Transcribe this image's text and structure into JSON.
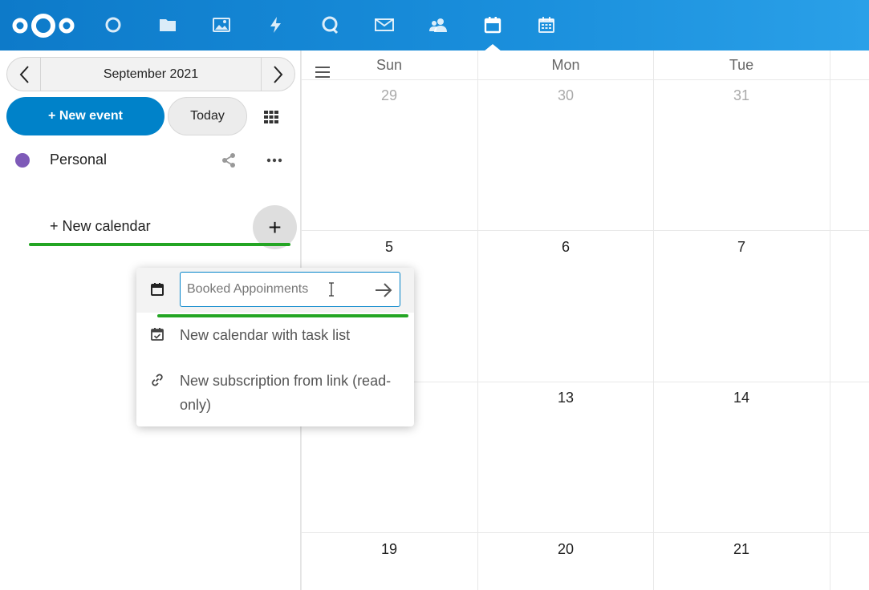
{
  "header": {
    "apps": [
      {
        "icon": "dashboard-icon"
      },
      {
        "icon": "files-icon"
      },
      {
        "icon": "photos-icon"
      },
      {
        "icon": "activity-icon"
      },
      {
        "icon": "talk-icon"
      },
      {
        "icon": "mail-icon"
      },
      {
        "icon": "contacts-icon"
      },
      {
        "icon": "calendar-icon"
      },
      {
        "icon": "appointments-icon"
      }
    ],
    "active_app": "calendar-icon",
    "colors": {
      "gradient_start": "#0d7ac9",
      "gradient_end": "#2aa0e8"
    }
  },
  "sidebar": {
    "month_label": "September 2021",
    "new_event_label": "+ New event",
    "today_label": "Today",
    "calendars": [
      {
        "name": "Personal",
        "color": "#7e5ab8"
      }
    ],
    "new_calendar_label": "+ New calendar",
    "plus_symbol": "+"
  },
  "popover": {
    "input_placeholder": "Booked Appoinments",
    "items": [
      {
        "label": "New calendar with task list",
        "icon": "calendar-check-icon"
      },
      {
        "label": "New subscription from link (read-only)",
        "icon": "link-icon"
      }
    ]
  },
  "calendar": {
    "day_headers": [
      "Sun",
      "Mon",
      "Tue"
    ],
    "weeks": [
      [
        "29",
        "30",
        "31"
      ],
      [
        "5",
        "6",
        "7"
      ],
      [
        "",
        "13",
        "14"
      ],
      [
        "19",
        "20",
        "21"
      ]
    ],
    "muted_week_index": 0
  },
  "accent_color": "#0082c9",
  "annotation_color": "#23a523"
}
